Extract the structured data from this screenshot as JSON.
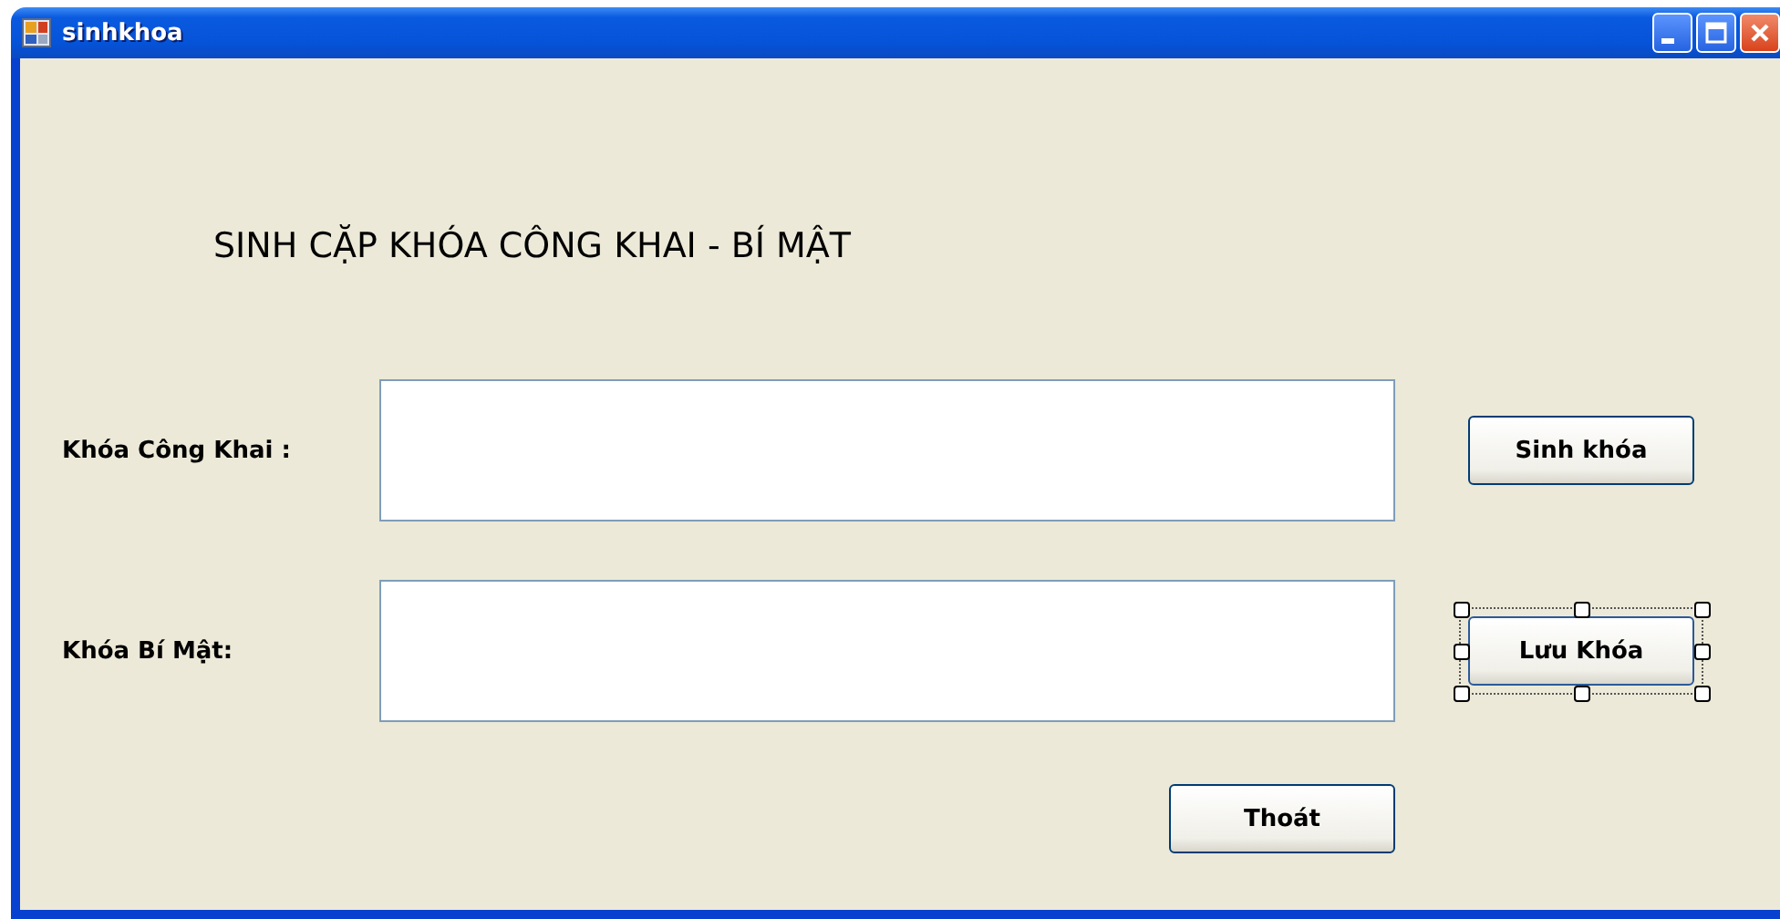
{
  "window": {
    "title": "sinhkhoa"
  },
  "heading": "SINH CẶP KHÓA CÔNG KHAI - BÍ MẬT",
  "rows": [
    {
      "label": "Khóa Công Khai :",
      "button": {
        "label": "Sinh khóa",
        "selected": false
      }
    },
    {
      "label": "Khóa Bí Mật:",
      "button": {
        "label": "Lưu Khóa",
        "selected": true
      }
    }
  ],
  "exit_button": {
    "label": "Thoát",
    "selected": false
  }
}
